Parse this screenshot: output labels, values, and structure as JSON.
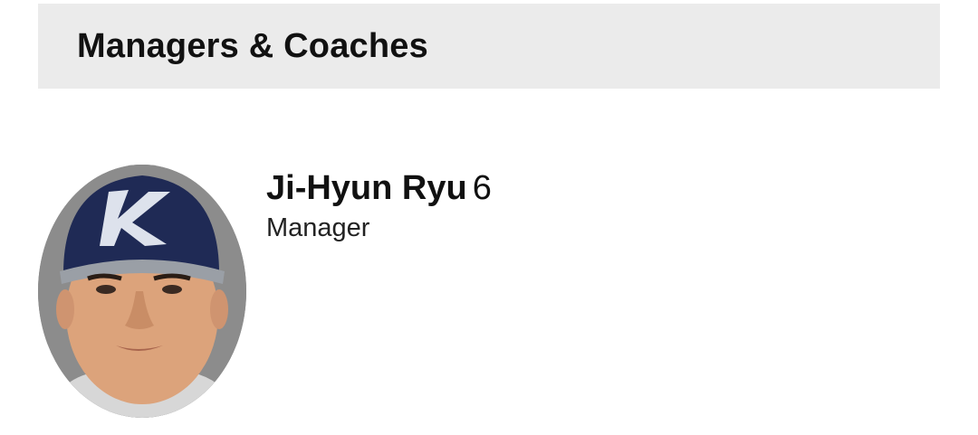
{
  "section": {
    "title": "Managers & Coaches"
  },
  "staff": [
    {
      "name": "Ji-Hyun Ryu",
      "number": "6",
      "role": "Manager",
      "avatar_icon": "player-headshot",
      "cap_logo": "K"
    }
  ],
  "colors": {
    "header_bg": "#ebebeb",
    "cap_navy": "#1f2a55",
    "cap_brim": "#9a9fa6",
    "photo_bg": "#8a8a8a"
  }
}
